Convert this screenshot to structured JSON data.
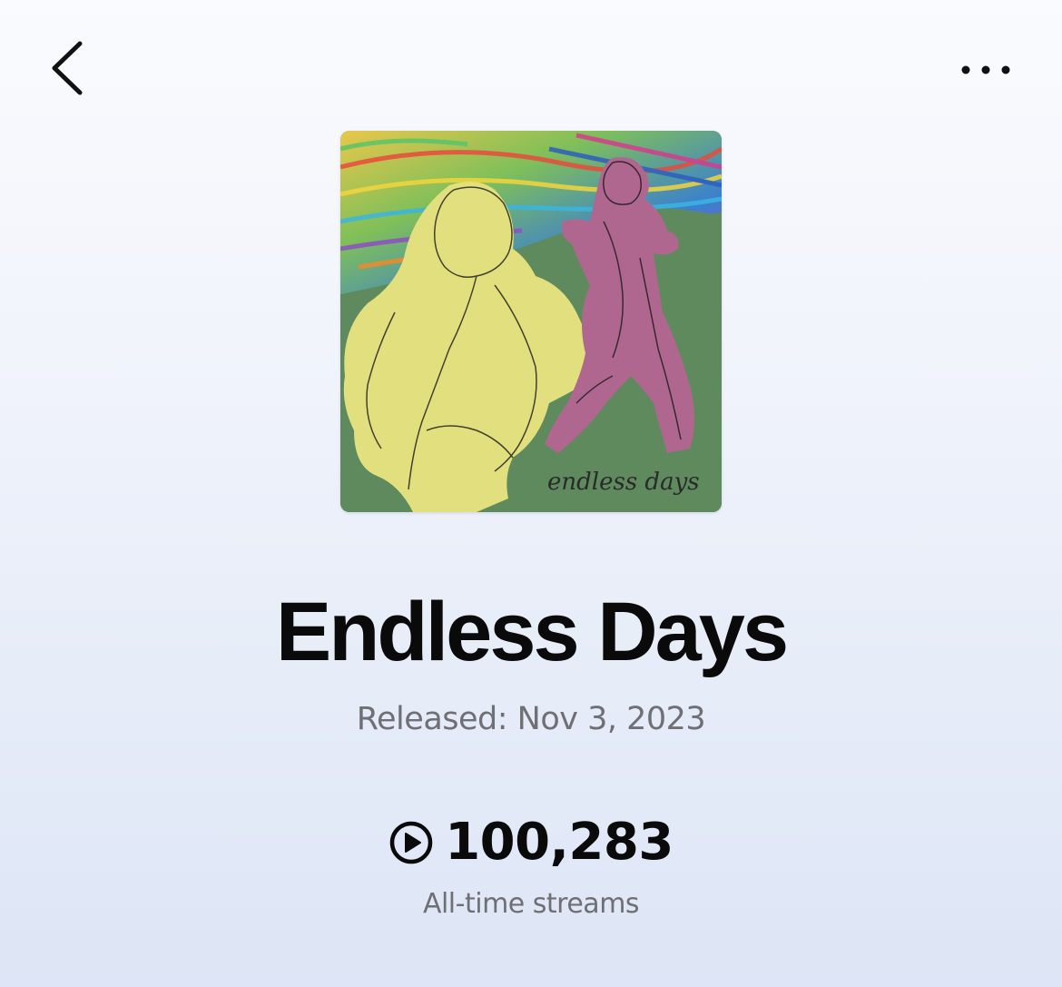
{
  "header": {
    "back_icon": "chevron-left-icon",
    "more_icon": "more-horizontal-icon"
  },
  "album": {
    "cover_text": "endless days",
    "title": "Endless Days",
    "released": "Released: Nov 3, 2023"
  },
  "stats": {
    "play_icon": "play-circle-icon",
    "streams": "100,283",
    "streams_label": "All-time streams"
  },
  "colors": {
    "background_top": "#fafbfe",
    "background_bottom": "#dde5f6",
    "title": "#0a0a0a",
    "secondary_text": "#6f6f74",
    "cover_green": "#5f8a5e",
    "cover_yellow": "#e2e07e",
    "cover_magenta": "#b0678f"
  }
}
